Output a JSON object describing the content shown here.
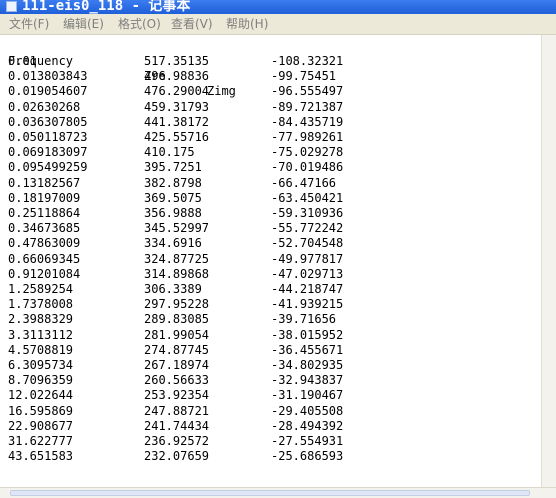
{
  "window": {
    "title": "111-eis0_118 - 记事本"
  },
  "menu": [
    "文件(F)",
    "编辑(E)",
    "格式(O)",
    "查看(V)",
    "帮助(H)"
  ],
  "table": {
    "headers": [
      "Frequency",
      "Zre",
      "Zimg"
    ],
    "rows": [
      [
        "0.01",
        "517.35135",
        "-108.32321"
      ],
      [
        "0.013803843",
        "496.98836",
        "-99.75451"
      ],
      [
        "0.019054607",
        "476.29004",
        "-96.555497"
      ],
      [
        "0.02630268",
        "459.31793",
        "-89.721387"
      ],
      [
        "0.036307805",
        "441.38172",
        "-84.435719"
      ],
      [
        "0.050118723",
        "425.55716",
        "-77.989261"
      ],
      [
        "0.069183097",
        "410.175",
        "-75.029278"
      ],
      [
        "0.095499259",
        "395.7251",
        "-70.019486"
      ],
      [
        "0.13182567",
        "382.8798",
        "-66.47166"
      ],
      [
        "0.18197009",
        "369.5075",
        "-63.450421"
      ],
      [
        "0.25118864",
        "356.9888",
        "-59.310936"
      ],
      [
        "0.34673685",
        "345.52997",
        "-55.772242"
      ],
      [
        "0.47863009",
        "334.6916",
        "-52.704548"
      ],
      [
        "0.66069345",
        "324.87725",
        "-49.977817"
      ],
      [
        "0.91201084",
        "314.89868",
        "-47.029713"
      ],
      [
        "1.2589254",
        "306.3389",
        "-44.218747"
      ],
      [
        "1.7378008",
        "297.95228",
        "-41.939215"
      ],
      [
        "2.3988329",
        "289.83085",
        "-39.71656"
      ],
      [
        "3.3113112",
        "281.99054",
        "-38.015952"
      ],
      [
        "4.5708819",
        "274.87745",
        "-36.455671"
      ],
      [
        "6.3095734",
        "267.18974",
        "-34.802935"
      ],
      [
        "8.7096359",
        "260.56633",
        "-32.943837"
      ],
      [
        "12.022644",
        "253.92354",
        "-31.190467"
      ],
      [
        "16.595869",
        "247.88721",
        "-29.405508"
      ],
      [
        "22.908677",
        "241.74434",
        "-28.494392"
      ],
      [
        "31.622777",
        "236.92572",
        "-27.554931"
      ],
      [
        "43.651583",
        "232.07659",
        "-25.686593"
      ]
    ]
  },
  "colors": {
    "titlebar": "#245edb",
    "menubar": "#ece9d8",
    "menu_text": "#7f7f7f"
  }
}
